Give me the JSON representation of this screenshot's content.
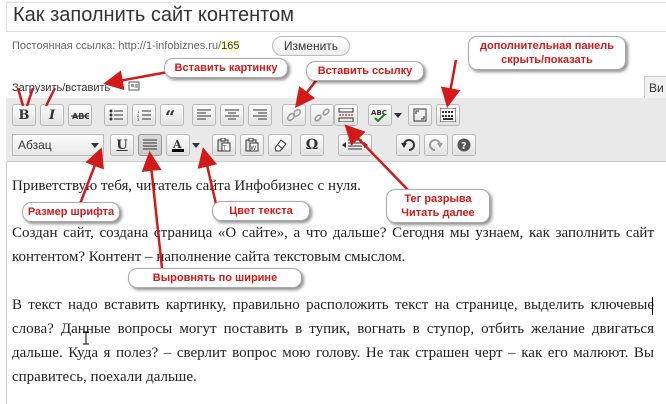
{
  "post": {
    "title": "Как заполнить сайт контентом",
    "permalink_label": "Постоянная ссылка:",
    "permalink_base": "http://1-infobiznes.ru/",
    "permalink_slug": "165",
    "edit_button": "Изменить"
  },
  "media": {
    "upload_label": "Загрузить/вставить"
  },
  "tabs": {
    "visual_partial": "Ви"
  },
  "toolbar": {
    "format_select": "Абзац",
    "row1": [
      "bold-icon",
      "italic-icon",
      "strikethrough-icon",
      "bullet-list-icon",
      "numbered-list-icon",
      "blockquote-icon",
      "align-left-icon",
      "align-center-icon",
      "align-right-icon",
      "insert-link-icon",
      "unlink-icon",
      "read-more-icon",
      "spellcheck-icon",
      "fullscreen-icon",
      "kitchen-sink-icon"
    ],
    "row2": [
      "underline-icon",
      "align-justify-icon",
      "text-color-icon",
      "paste-text-icon",
      "paste-word-icon",
      "clear-formatting-icon",
      "special-char-icon",
      "outdent-icon",
      "indent-icon",
      "undo-icon",
      "redo-icon",
      "help-icon"
    ],
    "bold_glyph": "B",
    "italic_glyph": "I",
    "underline_glyph": "U",
    "omega_glyph": "Ω",
    "textcolor_glyph": "A"
  },
  "content": {
    "p1": "Приветствую тебя, читатель сайта Инфобизнес с нуля.",
    "p2": "Создан сайт, создана страница «О сайте», а что дальше? Сегодня мы узнаем, как заполнить сайт контентом? Контент – наполнение сайта текстовым смыслом.",
    "p3": "В текст надо вставить картинку, правильно расположить текст на странице, выделить ключевые слова? Данные вопросы могут поставить в тупик, вогнать в ступор, отбить желание двигаться дальше. Куда я полез? – сверлит вопрос мою голову. Не так страшен черт – как его малюют. Вы справитесь, поехали дальше."
  },
  "callouts": {
    "insert_image": "Вставить картинку",
    "insert_link": "Вставить ссылку",
    "extra_panel_line1": "дополнительная панель",
    "extra_panel_line2": "скрыть/показать",
    "font_size": "Размер шрифта",
    "text_color": "Цвет текста",
    "break_line1": "Тег разрыва",
    "break_line2": "Читать далее",
    "justify": "Выровнять по ширине"
  },
  "colors": {
    "annotation_red": "#d21a1a",
    "toolbar_bg": "#e9e9e9"
  }
}
